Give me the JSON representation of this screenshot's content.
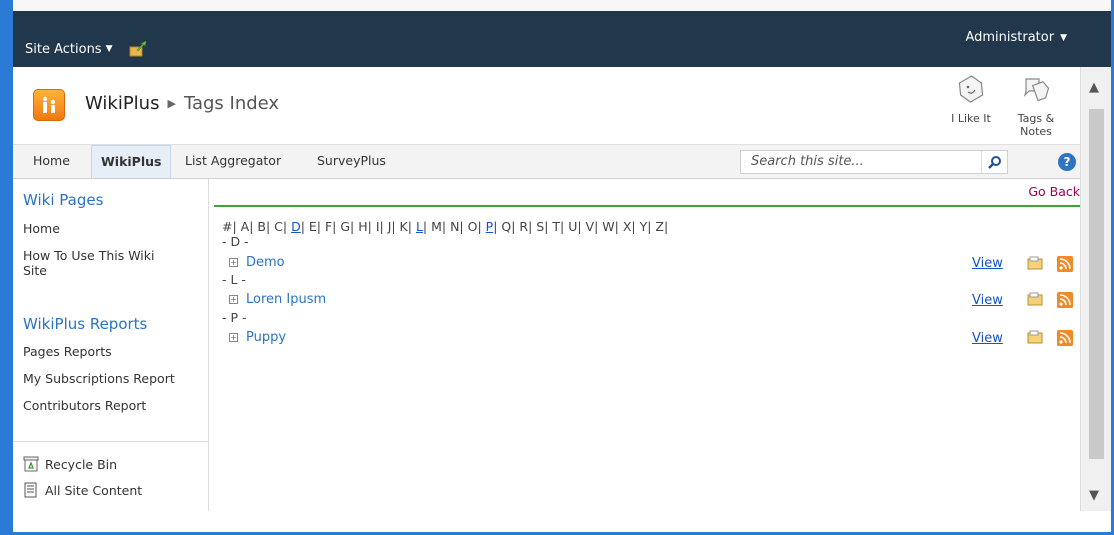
{
  "topbar": {
    "site_actions": "Site Actions",
    "user": "Administrator"
  },
  "title": {
    "site": "WikiPlus",
    "page": "Tags Index",
    "like_label": "I Like It",
    "tags_label_line1": "Tags &",
    "tags_label_line2": "Notes"
  },
  "nav": {
    "items": [
      "Home",
      "WikiPlus",
      "List Aggregator",
      "SurveyPlus"
    ],
    "selected": "WikiPlus",
    "search_placeholder": "Search this site...",
    "help": "?"
  },
  "sidebar": {
    "wiki_heading": "Wiki Pages",
    "wiki_items": [
      "Home",
      "How To Use This Wiki",
      "Site"
    ],
    "reports_heading": "WikiPlus Reports",
    "report_items": [
      "Pages Reports",
      "My Subscriptions Report",
      "Contributors Report"
    ],
    "recycle": "Recycle Bin",
    "all_content": "All Site Content"
  },
  "main": {
    "go_back": "Go Back",
    "alphabet": {
      "before_d": "#| A| B| C| ",
      "d": "D",
      "d_to_l": "| E| F| G| H| I| J| K| ",
      "l": "L",
      "l_to_p": "| M| N| O| ",
      "p": "P",
      "after_p": "| Q| R| S| T| U| V| W| X| Y| Z|"
    },
    "groups": [
      {
        "label": "- D -",
        "page": "Demo",
        "view": "View"
      },
      {
        "label": "- L -",
        "page": "Loren Ipusm",
        "view": "View"
      },
      {
        "label": "- P -",
        "page": "Puppy",
        "view": "View"
      }
    ]
  },
  "colors": {
    "topbar": "#21374c",
    "link": "#2a74c4",
    "go_back": "#a00050",
    "accent_green": "#3aa33a",
    "frame_blue": "#2b7ad6"
  }
}
